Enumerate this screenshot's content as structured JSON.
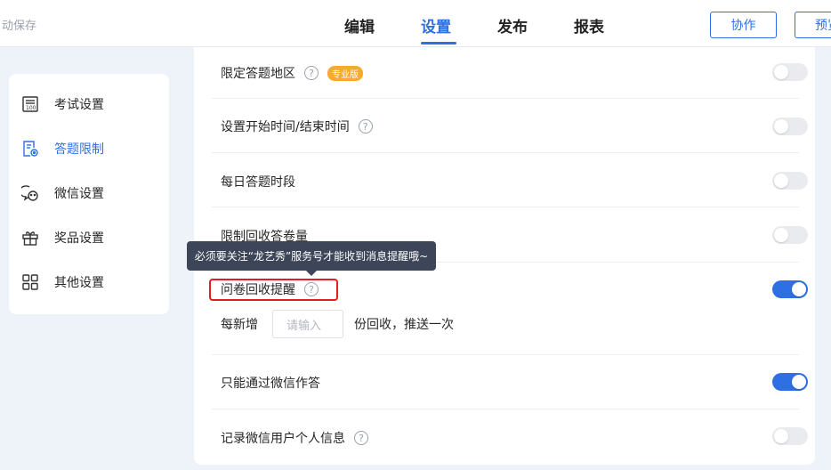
{
  "header": {
    "autosave": "动保存",
    "tabs": [
      {
        "label": "编辑",
        "active": false
      },
      {
        "label": "设置",
        "active": true
      },
      {
        "label": "发布",
        "active": false
      },
      {
        "label": "报表",
        "active": false
      }
    ],
    "collab_button": "协作",
    "preview_button": "预览"
  },
  "sidebar": {
    "items": [
      {
        "label": "考试设置",
        "icon": "exam-icon",
        "active": false
      },
      {
        "label": "答题限制",
        "icon": "answer-limit-icon",
        "active": true
      },
      {
        "label": "微信设置",
        "icon": "wechat-icon",
        "active": false
      },
      {
        "label": "奖品设置",
        "icon": "gift-icon",
        "active": false
      },
      {
        "label": "其他设置",
        "icon": "grid-icon",
        "active": false
      }
    ]
  },
  "settings": {
    "rows": [
      {
        "label": "限定答题地区",
        "help": true,
        "badge": "专业版",
        "enabled": false
      },
      {
        "label": "设置开始时间/结束时间",
        "help": true,
        "enabled": false
      },
      {
        "label": "每日答题时段",
        "help": false,
        "enabled": false
      },
      {
        "label": "限制回收答卷量",
        "help": false,
        "enabled": false
      },
      {
        "label": "问卷回收提醒",
        "help": true,
        "enabled": true
      },
      {
        "label": "只能通过微信作答",
        "help": false,
        "enabled": true
      },
      {
        "label": "记录微信用户个人信息",
        "help": true,
        "enabled": false
      }
    ],
    "reminder": {
      "prefix": "每新增",
      "placeholder": "请输入",
      "suffix": "份回收，推送一次"
    }
  },
  "tooltip": {
    "text": "必须要关注“龙艺秀”服务号才能收到消息提醒哦~"
  },
  "colors": {
    "accent": "#2f6fe4",
    "badge": "#f6ab2f",
    "highlight": "#e01f1f",
    "tooltip_bg": "#3c4658"
  },
  "help_glyph": "?"
}
